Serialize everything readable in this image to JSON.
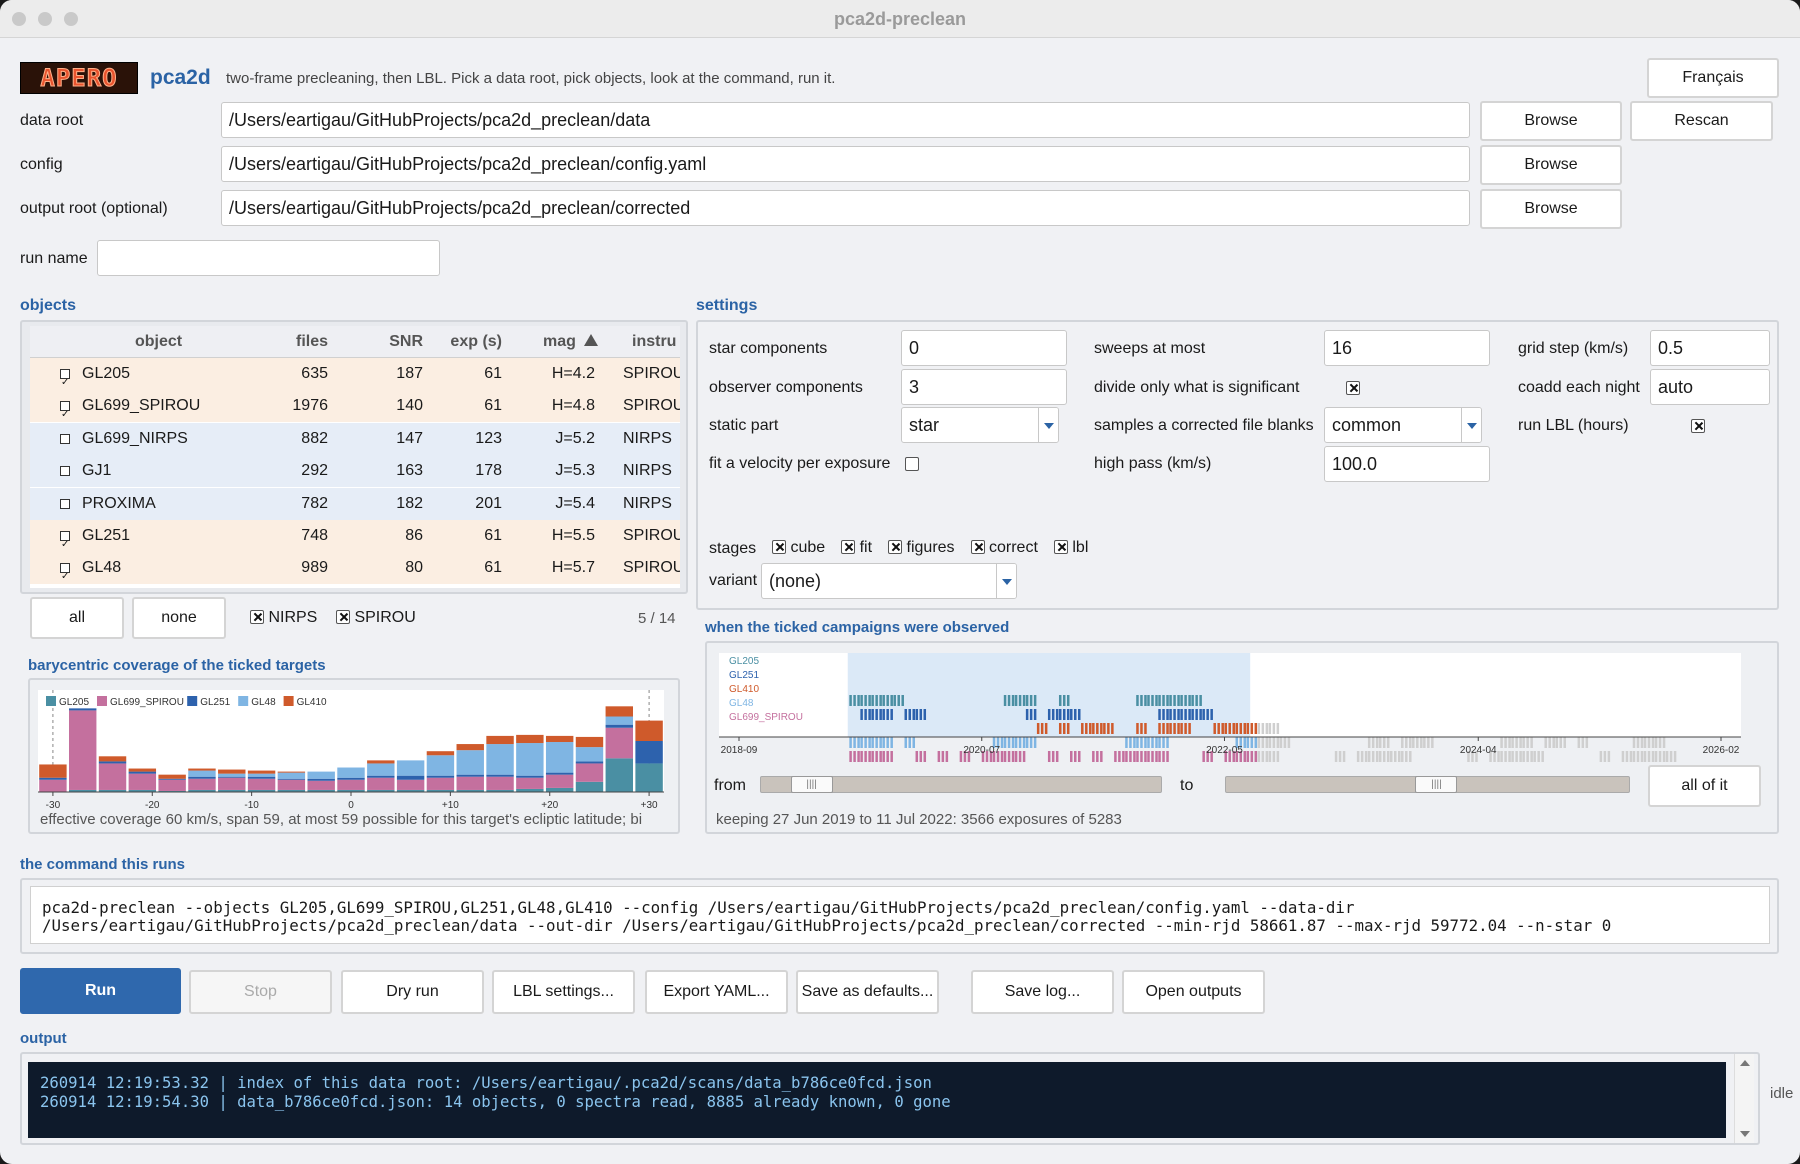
{
  "window": {
    "title": "pca2d-preclean"
  },
  "header": {
    "logo": "APERO",
    "app": "pca2d",
    "tagline": "two-frame precleaning, then LBL. Pick a data root, pick objects, look at the command, run it.",
    "lang_button": "Français"
  },
  "paths": {
    "data_root": {
      "label": "data root",
      "value": "/Users/eartigau/GitHubProjects/pca2d_preclean/data"
    },
    "config": {
      "label": "config",
      "value": "/Users/eartigau/GitHubProjects/pca2d_preclean/config.yaml"
    },
    "output_root": {
      "label": "output root (optional)",
      "value": "/Users/eartigau/GitHubProjects/pca2d_preclean/corrected"
    },
    "run_name": {
      "label": "run name",
      "value": ""
    },
    "browse": "Browse",
    "rescan": "Rescan"
  },
  "objects": {
    "title": "objects",
    "columns": [
      "object",
      "files",
      "SNR",
      "exp (s)",
      "mag",
      "instru"
    ],
    "rows": [
      {
        "checked": true,
        "name": "GL205",
        "files": "635",
        "snr": "187",
        "exp": "61",
        "mag": "H=4.2",
        "inst": "SPIROU"
      },
      {
        "checked": true,
        "name": "GL699_SPIROU",
        "files": "1976",
        "snr": "140",
        "exp": "61",
        "mag": "H=4.8",
        "inst": "SPIROU"
      },
      {
        "checked": false,
        "name": "GL699_NIRPS",
        "files": "882",
        "snr": "147",
        "exp": "123",
        "mag": "J=5.2",
        "inst": "NIRPS"
      },
      {
        "checked": false,
        "name": "GJ1",
        "files": "292",
        "snr": "163",
        "exp": "178",
        "mag": "J=5.3",
        "inst": "NIRPS"
      },
      {
        "checked": false,
        "name": "PROXIMA",
        "files": "782",
        "snr": "182",
        "exp": "201",
        "mag": "J=5.4",
        "inst": "NIRPS"
      },
      {
        "checked": true,
        "name": "GL251",
        "files": "748",
        "snr": "86",
        "exp": "61",
        "mag": "H=5.5",
        "inst": "SPIROU"
      },
      {
        "checked": true,
        "name": "GL48",
        "files": "989",
        "snr": "80",
        "exp": "61",
        "mag": "H=5.7",
        "inst": "SPIROU"
      }
    ],
    "all": "all",
    "none": "none",
    "filter_nirps": "NIRPS",
    "filter_spirou": "SPIROU",
    "count": "5 / 14"
  },
  "settings": {
    "title": "settings",
    "star_components": {
      "label": "star components",
      "value": "0"
    },
    "observer_components": {
      "label": "observer components",
      "value": "3"
    },
    "static_part": {
      "label": "static part",
      "value": "star"
    },
    "fit_velocity": {
      "label": "fit a velocity per exposure",
      "checked": false
    },
    "sweeps": {
      "label": "sweeps at most",
      "value": "16"
    },
    "divide": {
      "label": "divide only what is significant",
      "checked": true
    },
    "samples": {
      "label": "samples a corrected file blanks",
      "value": "common"
    },
    "high_pass": {
      "label": "high pass (km/s)",
      "value": "100.0"
    },
    "grid_step": {
      "label": "grid step (km/s)",
      "value": "0.5"
    },
    "coadd": {
      "label": "coadd each night",
      "value": "auto"
    },
    "run_lbl": {
      "label": "run LBL (hours)",
      "checked": true
    },
    "stages": {
      "label": "stages",
      "items": [
        {
          "label": "cube",
          "checked": true
        },
        {
          "label": "fit",
          "checked": true
        },
        {
          "label": "figures",
          "checked": true
        },
        {
          "label": "correct",
          "checked": true
        },
        {
          "label": "lbl",
          "checked": true
        }
      ]
    },
    "variant": {
      "label": "variant",
      "value": "(none)"
    }
  },
  "coverage": {
    "title": "barycentric coverage of the ticked targets",
    "caption": "effective coverage 60 km/s, span 59, at most 59 possible for this target's ecliptic latitude; bi"
  },
  "timeline": {
    "title": "when the ticked campaigns were observed",
    "from": "from",
    "to": "to",
    "all": "all of it",
    "caption": "keeping 27 Jun 2019 to 11 Jul 2022: 3566 exposures of 5283",
    "range_start": "2019-06-27",
    "range_end": "2022-07-11"
  },
  "command": {
    "title": "the command this runs",
    "line1": "pca2d-preclean --objects GL205,GL699_SPIROU,GL251,GL48,GL410 --config /Users/eartigau/GitHubProjects/pca2d_preclean/config.yaml --data-dir",
    "line2": "/Users/eartigau/GitHubProjects/pca2d_preclean/data --out-dir /Users/eartigau/GitHubProjects/pca2d_preclean/corrected --min-rjd 58661.87 --max-rjd 59772.04 --n-star 0"
  },
  "actions": {
    "run": "Run",
    "stop": "Stop",
    "dry": "Dry run",
    "lbl": "LBL settings...",
    "export": "Export YAML...",
    "defaults": "Save as defaults...",
    "savelog": "Save log...",
    "open": "Open outputs"
  },
  "output": {
    "title": "output",
    "lines": [
      "260914 12:19:53.32 | index of this data root: /Users/eartigau/.pca2d/scans/data_b786ce0fcd.json",
      "260914 12:19:54.30 | data_b786ce0fcd.json: 14 objects, 0 spectra read, 8885 already known, 0 gone"
    ],
    "status": "idle"
  },
  "colors": {
    "accent": "#2b63a5",
    "GL205": "#4a8fa3",
    "GL699_SPIROU": "#c4709e",
    "GL251": "#2d62ad",
    "GL48": "#7fb5e3",
    "GL410": "#cf5a2b",
    "spirou_row": "#fbeee2",
    "nirps_row": "#e6edf7",
    "terminal": "#0e1a2b"
  },
  "chart_data": [
    {
      "type": "bar",
      "title": "",
      "stacked": true,
      "x": [
        -30,
        -27,
        -24,
        -21,
        -18,
        -15,
        -12,
        -9,
        -6,
        -3,
        0,
        3,
        6,
        9,
        12,
        15,
        18,
        21,
        24,
        27,
        30
      ],
      "xticks": [
        "-30",
        "-20",
        "-10",
        "0",
        "+10",
        "+20",
        "+30"
      ],
      "xtick_values": [
        -30,
        -20,
        -10,
        0,
        10,
        20,
        30
      ],
      "xlim": [
        -31.5,
        31.5
      ],
      "ylim": [
        0,
        100
      ],
      "series": [
        {
          "name": "GL205",
          "color": "#4a8fa3",
          "values": [
            0,
            2,
            2,
            2,
            1,
            2,
            2,
            2,
            2,
            2,
            2,
            2,
            2,
            2,
            2,
            2,
            3,
            4,
            10,
            33,
            28
          ]
        },
        {
          "name": "GL699_SPIROU",
          "color": "#c4709e",
          "values": [
            12,
            78,
            26,
            16,
            11,
            11,
            12,
            11,
            10,
            9,
            10,
            12,
            10,
            12,
            13,
            13,
            11,
            13,
            18,
            30,
            0
          ]
        },
        {
          "name": "GL251",
          "color": "#2d62ad",
          "values": [
            2,
            2,
            2,
            2,
            1,
            2,
            1,
            2,
            1,
            2,
            2,
            2,
            4,
            2,
            2,
            2,
            2,
            2,
            2,
            3,
            22
          ]
        },
        {
          "name": "GL48",
          "color": "#7fb5e3",
          "values": [
            0,
            0,
            0,
            0,
            0,
            6,
            3,
            3,
            6,
            7,
            10,
            12,
            15,
            20,
            24,
            30,
            32,
            30,
            14,
            8,
            0
          ]
        },
        {
          "name": "GL410",
          "color": "#cf5a2b",
          "values": [
            13,
            0,
            5,
            3,
            4,
            2,
            4,
            3,
            1,
            0,
            0,
            3,
            0,
            4,
            6,
            8,
            8,
            6,
            10,
            10,
            20
          ]
        }
      ]
    },
    {
      "type": "scatter",
      "title": "",
      "xticks": [
        "2018-09",
        "2020-07",
        "2022-05",
        "2024-04",
        "2026-02"
      ],
      "series": [
        {
          "name": "GL205",
          "color": "#4a8fa3",
          "x": [
            "2019-07",
            "2019-08",
            "2019-09",
            "2019-10",
            "2019-11",
            "2020-09",
            "2020-10",
            "2020-11",
            "2021-02",
            "2021-09",
            "2021-10",
            "2021-11",
            "2021-12",
            "2022-01",
            "2022-02"
          ]
        },
        {
          "name": "GL251",
          "color": "#2d62ad",
          "x": [
            "2019-08",
            "2019-09",
            "2019-10",
            "2019-12",
            "2020-01",
            "2020-11",
            "2021-01",
            "2021-02",
            "2021-03",
            "2021-11",
            "2021-12",
            "2022-01",
            "2022-02",
            "2022-03"
          ]
        },
        {
          "name": "GL410",
          "color": "#cf5a2b",
          "x": [
            "2020-12",
            "2021-02",
            "2021-04",
            "2021-05",
            "2021-06",
            "2021-09",
            "2021-11",
            "2021-12",
            "2022-01",
            "2022-04",
            "2022-05",
            "2022-06",
            "2022-07",
            "2022-08",
            "2022-09"
          ]
        },
        {
          "name": "GL48",
          "color": "#7fb5e3",
          "x": [
            "2019-07",
            "2019-08",
            "2019-09",
            "2019-10",
            "2019-12",
            "2020-08",
            "2020-09",
            "2020-10",
            "2020-11",
            "2021-08",
            "2021-09",
            "2021-10",
            "2021-11",
            "2022-06",
            "2022-07",
            "2022-08",
            "2022-09",
            "2022-10",
            "2023-06",
            "2023-07",
            "2023-09",
            "2023-10",
            "2023-11",
            "2024-06",
            "2024-07",
            "2024-08",
            "2024-10",
            "2024-11",
            "2025-01",
            "2025-06",
            "2025-07",
            "2025-08"
          ]
        },
        {
          "name": "GL699_SPIROU",
          "color": "#c4709e",
          "x": [
            "2019-07",
            "2019-08",
            "2019-09",
            "2019-10",
            "2020-01",
            "2020-03",
            "2020-05",
            "2020-07",
            "2020-08",
            "2020-09",
            "2020-10",
            "2021-01",
            "2021-03",
            "2021-05",
            "2021-07",
            "2021-08",
            "2021-09",
            "2021-10",
            "2021-11",
            "2022-03",
            "2022-05",
            "2022-06",
            "2022-07",
            "2022-08",
            "2022-09",
            "2023-03",
            "2023-05",
            "2023-06",
            "2023-07",
            "2023-08",
            "2023-09",
            "2024-03",
            "2024-05",
            "2024-06",
            "2024-07",
            "2024-08",
            "2024-09",
            "2025-03",
            "2025-05",
            "2025-06",
            "2025-07",
            "2025-08",
            "2025-09"
          ]
        }
      ]
    }
  ]
}
